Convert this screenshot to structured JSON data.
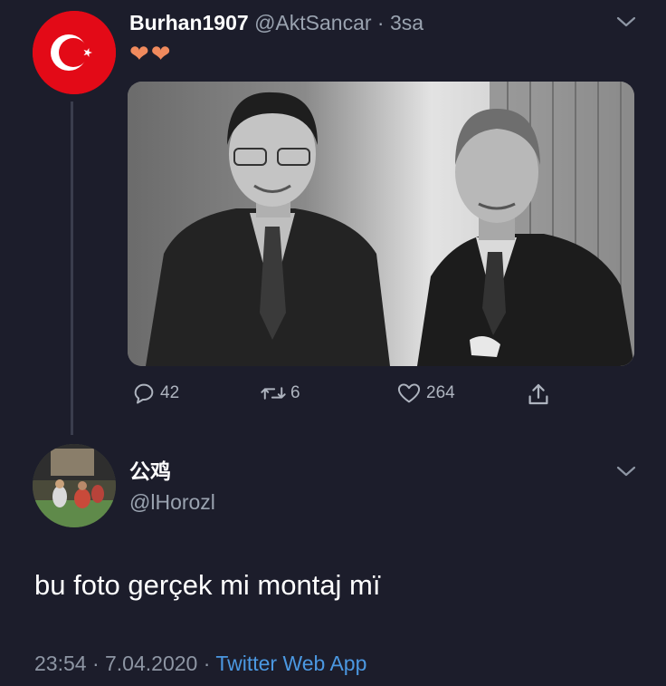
{
  "tweet": {
    "display_name": "Burhan1907",
    "handle": "@AktSancar",
    "separator": " · ",
    "time_ago": "3sa",
    "text_emoji": "❤❤",
    "avatar_icon": "turkish-flag-icon",
    "actions": {
      "replies": "42",
      "retweets": "6",
      "likes": "264"
    }
  },
  "reply": {
    "display_name": "公鸡",
    "handle": "@lHorozl",
    "text": "bu foto gerçek mi montaj mï",
    "timestamp": "23:54 · 7.04.2020 · ",
    "source": "Twitter Web App"
  },
  "colors": {
    "background": "#1c1d2b",
    "link": "#4b98e1",
    "flag_red": "#e30a17",
    "heart": "#f08a5d"
  }
}
